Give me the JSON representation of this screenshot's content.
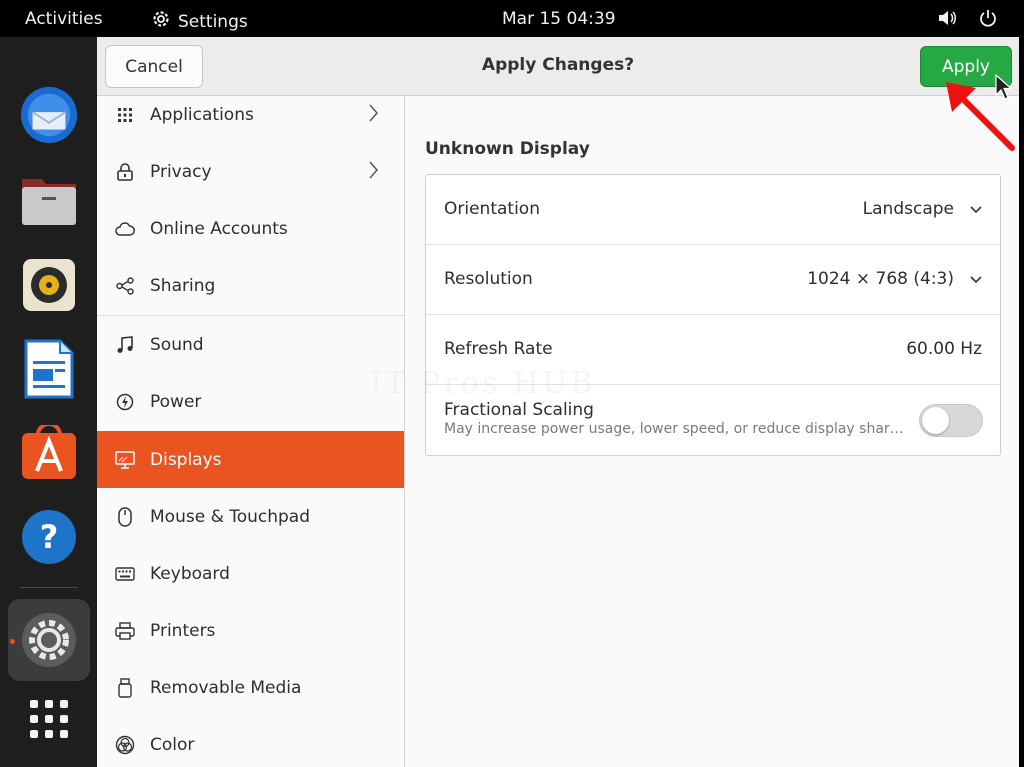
{
  "topbar": {
    "activities": "Activities",
    "app_name": "Settings",
    "clock": "Mar 15  04:39"
  },
  "dock": {
    "items": [
      "thunderbird-icon",
      "files-icon",
      "rhythmbox-icon",
      "libreoffice-writer-icon",
      "app-center-icon",
      "help-icon",
      "settings-icon",
      "show-apps-icon"
    ]
  },
  "headerbar": {
    "cancel_label": "Cancel",
    "title": "Apply Changes?",
    "apply_label": "Apply"
  },
  "sidebar": {
    "items": [
      {
        "label": "Applications",
        "icon": "grid-icon",
        "chevron": true
      },
      {
        "label": "Privacy",
        "icon": "lock-icon",
        "chevron": true
      },
      {
        "label": "Online Accounts",
        "icon": "cloud-icon"
      },
      {
        "label": "Sharing",
        "icon": "share-icon"
      },
      {
        "label": "Sound",
        "icon": "music-note-icon"
      },
      {
        "label": "Power",
        "icon": "power-icon"
      },
      {
        "label": "Displays",
        "icon": "display-icon",
        "active": true
      },
      {
        "label": "Mouse & Touchpad",
        "icon": "mouse-icon"
      },
      {
        "label": "Keyboard",
        "icon": "keyboard-icon"
      },
      {
        "label": "Printers",
        "icon": "printer-icon"
      },
      {
        "label": "Removable Media",
        "icon": "usb-drive-icon"
      },
      {
        "label": "Color",
        "icon": "color-icon"
      }
    ]
  },
  "display": {
    "section_title": "Unknown Display",
    "orientation": {
      "label": "Orientation",
      "value": "Landscape"
    },
    "resolution": {
      "label": "Resolution",
      "value": "1024 × 768 (4:3)"
    },
    "refresh_rate": {
      "label": "Refresh Rate",
      "value": "60.00 Hz"
    },
    "fractional_scaling": {
      "label": "Fractional Scaling",
      "description": "May increase power usage, lower speed, or reduce display shar…",
      "enabled": false
    }
  },
  "watermark": "IT Pros HUB",
  "colors": {
    "accent": "#e95420",
    "apply": "#26a844",
    "arrow": "#ee1111"
  }
}
